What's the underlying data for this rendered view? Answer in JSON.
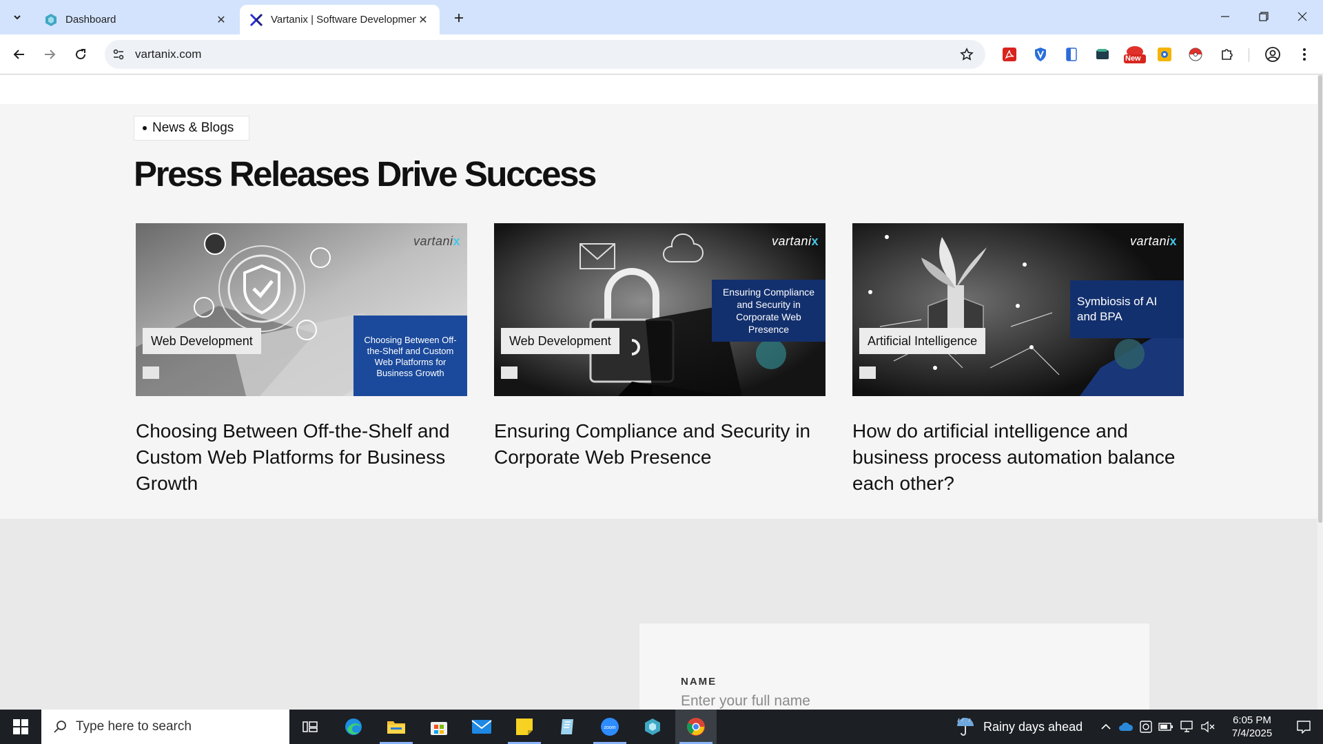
{
  "browser": {
    "tabs": [
      {
        "title": "Dashboard",
        "active": false
      },
      {
        "title": "Vartanix | Software Development",
        "active": true
      }
    ],
    "url": "vartanix.com",
    "extensions": [
      "acrobat-icon",
      "shield-icon",
      "document-icon",
      "wallet-icon",
      "new-badge-icon",
      "camera-icon",
      "pokeball-icon",
      "puzzle-icon"
    ],
    "new_badge": "New"
  },
  "page": {
    "section_tag": "News & Blogs",
    "section_title": "Press Releases Drive Success",
    "brand": "vartani",
    "brand_mark": "x",
    "posts": [
      {
        "category": "Web Development",
        "image_caption": "Choosing Between Off-the-Shelf and Custom Web Platforms for Business Growth",
        "title": "Choosing Between Off-the-Shelf and Custom Web Platforms for Business Growth"
      },
      {
        "category": "Web Development",
        "image_caption": "Ensuring Compliance and Security in Corporate Web Presence",
        "title": "Ensuring Compliance and Security in Corporate Web Presence"
      },
      {
        "category": "Artificial Intelligence",
        "image_caption": "Symbiosis of AI and BPA",
        "title": "How do artificial intelligence and business process automation balance each other?"
      }
    ],
    "form": {
      "name_label": "NAME",
      "name_placeholder": "Enter your full name"
    }
  },
  "taskbar": {
    "search_placeholder": "Type here to search",
    "weather": "Rainy days ahead",
    "time": "6:05 PM",
    "date": "7/4/2025"
  },
  "colors": {
    "tabbar": "#d3e3fd",
    "accent_blue": "#1b4a9c",
    "brand_x": "#46c6e8"
  }
}
